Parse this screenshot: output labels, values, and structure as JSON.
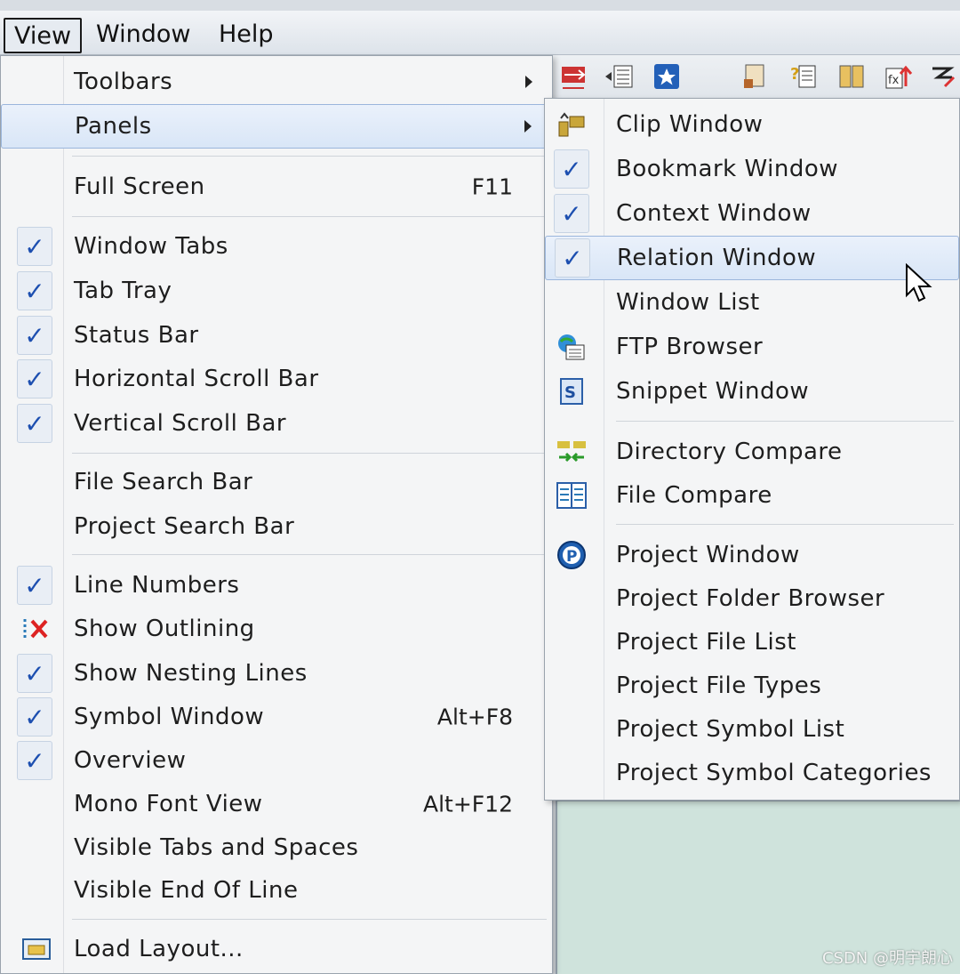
{
  "menubar": {
    "items": [
      {
        "label": "View"
      },
      {
        "label": "Window"
      },
      {
        "label": "Help"
      }
    ]
  },
  "view_menu": {
    "items": [
      {
        "label": "Toolbars",
        "submenu": true
      },
      {
        "label": "Panels",
        "submenu": true,
        "highlighted": true
      },
      {
        "label": "Full Screen",
        "shortcut": "F11"
      },
      {
        "label": "Window Tabs",
        "checked": true
      },
      {
        "label": "Tab Tray",
        "checked": true
      },
      {
        "label": "Status Bar",
        "checked": true
      },
      {
        "label": "Horizontal Scroll Bar",
        "checked": true
      },
      {
        "label": "Vertical Scroll Bar",
        "checked": true
      },
      {
        "label": "File Search Bar"
      },
      {
        "label": "Project Search Bar"
      },
      {
        "label": "Line Numbers",
        "checked": true
      },
      {
        "label": "Show Outlining",
        "icon": "outline-x-icon"
      },
      {
        "label": "Show Nesting Lines",
        "checked": true
      },
      {
        "label": "Symbol Window",
        "shortcut": "Alt+F8",
        "checked": true
      },
      {
        "label": "Overview",
        "checked": true
      },
      {
        "label": "Mono Font View",
        "shortcut": "Alt+F12"
      },
      {
        "label": "Visible Tabs and Spaces"
      },
      {
        "label": "Visible End Of Line"
      },
      {
        "label": "Load Layout...",
        "icon": "folder-icon"
      }
    ]
  },
  "panels_submenu": {
    "items": [
      {
        "label": "Clip Window",
        "icon": "clip-icon"
      },
      {
        "label": "Bookmark Window",
        "checked": true
      },
      {
        "label": "Context Window",
        "checked": true
      },
      {
        "label": "Relation Window",
        "checked": true,
        "highlighted": true
      },
      {
        "label": "Window List"
      },
      {
        "label": "FTP Browser",
        "icon": "ftp-browser-icon"
      },
      {
        "label": "Snippet Window",
        "icon": "snippet-icon"
      },
      {
        "label": "Directory Compare",
        "icon": "directory-compare-icon"
      },
      {
        "label": "File Compare",
        "icon": "file-compare-icon"
      },
      {
        "label": "Project Window",
        "icon": "project-icon"
      },
      {
        "label": "Project Folder Browser"
      },
      {
        "label": "Project File List"
      },
      {
        "label": "Project File Types"
      },
      {
        "label": "Project Symbol List"
      },
      {
        "label": "Project Symbol Categories"
      }
    ]
  },
  "check_glyph": "✓",
  "cross_glyph": "✗",
  "watermark": "CSDN @明宇朗心",
  "colors": {
    "check": "#1d4fb0",
    "highlight": "#d9e6f7",
    "menu_bg": "#f4f5f6"
  }
}
